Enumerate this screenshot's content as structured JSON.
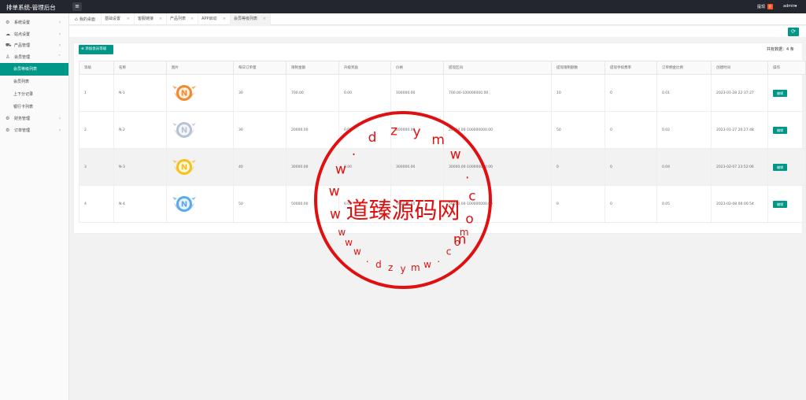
{
  "app": {
    "title": "排单系统-管理后台",
    "tixian_label": "提现",
    "tixian_count": "0",
    "user": "admin"
  },
  "sidebar": {
    "items": [
      {
        "label": "系统设置",
        "icon": "gear-icon"
      },
      {
        "label": "站点设置",
        "icon": "cloud-icon"
      },
      {
        "label": "产品管理",
        "icon": "cart-icon"
      },
      {
        "label": "会员管理",
        "icon": "user-icon"
      }
    ],
    "member_sub": [
      {
        "label": "会员等级列表",
        "active": true
      },
      {
        "label": "会员列表",
        "active": false
      },
      {
        "label": "上下分记录",
        "active": false
      },
      {
        "label": "银行卡列表",
        "active": false
      }
    ],
    "items_after": [
      {
        "label": "财务管理",
        "icon": "gear-icon"
      },
      {
        "label": "订单管理",
        "icon": "gear-icon"
      }
    ]
  },
  "tabs": [
    {
      "label": "我的桌面",
      "home": true
    },
    {
      "label": "基础设置"
    },
    {
      "label": "客服链接"
    },
    {
      "label": "产品列表"
    },
    {
      "label": "APP启动"
    },
    {
      "label": "会员等级列表",
      "active": true
    }
  ],
  "toolbar": {
    "add_label": "添加会员等级",
    "total_text": "共有数据：4 条"
  },
  "table": {
    "headers": [
      "等级",
      "名称",
      "图片",
      "每日订单量",
      "限制金额",
      "升级奖励",
      "价格",
      "提现区间",
      "提现限制额数",
      "提现手续费率",
      "订单佣金比例",
      "创建时间",
      "操作"
    ],
    "rows": [
      {
        "level": "1",
        "name": "N-1",
        "badge": "orange",
        "daily": "30",
        "limit": "700.00",
        "reward": "0.00",
        "price": "100000.00",
        "range": "700.00-100000000.00",
        "wd_limit": "10",
        "fee": "0",
        "commission": "0.01",
        "created": "2023-01-28 22:37:27",
        "action": "编辑"
      },
      {
        "level": "2",
        "name": "N-2",
        "badge": "silver",
        "daily": "30",
        "limit": "20000.00",
        "reward": "0.00",
        "price": "200000.00",
        "range": "20000.00-100000000.00",
        "wd_limit": "50",
        "fee": "0",
        "commission": "0.02",
        "created": "2023-01-27 20:27:48",
        "action": "编辑"
      },
      {
        "level": "3",
        "name": "N-3",
        "badge": "gold",
        "daily": "40",
        "limit": "30000.00",
        "reward": "0.00",
        "price": "300000.00",
        "range": "30000.00-100000000.00",
        "wd_limit": "0",
        "fee": "0",
        "commission": "0.04",
        "created": "2023-02-07 23:52:06",
        "action": "编辑"
      },
      {
        "level": "4",
        "name": "N-4",
        "badge": "blue",
        "daily": "50",
        "limit": "50000.00",
        "reward": "0.00",
        "price": "500000.00",
        "range": "50000.00-100000000.00",
        "wd_limit": "0",
        "fee": "0",
        "commission": "0.05",
        "created": "2023-02-08 00:00:54",
        "action": "编辑"
      }
    ]
  },
  "badge_colors": {
    "orange": "#f08a2c",
    "silver": "#b8c2d6",
    "gold": "#f5c21b",
    "blue": "#5aa9ec"
  },
  "watermark": {
    "url": "dzymw.com",
    "name": "道臻源码网",
    "color": "#e01010"
  }
}
